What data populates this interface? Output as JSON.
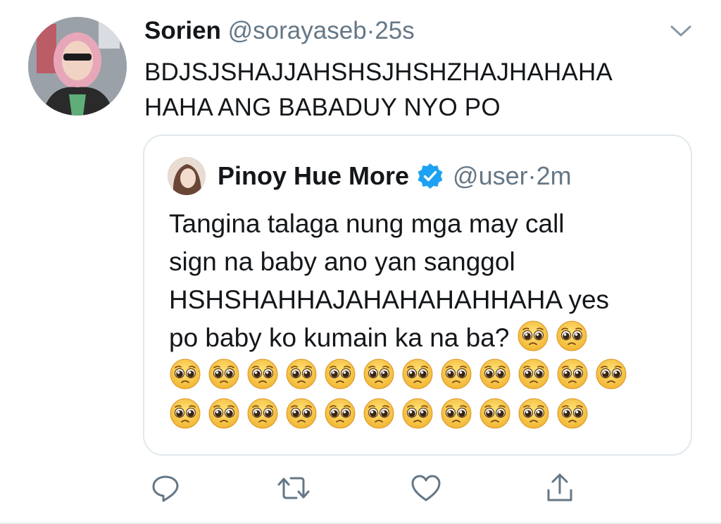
{
  "tweet": {
    "author_name": "Sorien",
    "author_handle": "@sorayaseb",
    "separator": "·",
    "time": "25s",
    "text_line1": "BDJSJSHAJJAHSHSJHSHZHAJHAHAHA",
    "text_line2": "HAHA ANG BABADUY NYO PO",
    "menu_icon": "chevron-down-icon"
  },
  "quoted_tweet": {
    "author_name": "Pinoy Hue More",
    "author_handle": "@user",
    "separator": "·",
    "time": "2m",
    "verified_icon": "verified-badge-icon",
    "text_line1": "Tangina talaga nung mga may call",
    "text_line2": "sign na baby ano yan sanggol",
    "text_line3": "HSHSHAHHAJAHAHAHAHHAHA yes",
    "text_line4": "po baby ko kumain ka na ba?",
    "emoji": "pleading-face",
    "emoji_count_line4": 2,
    "emoji_count_row2": 12,
    "emoji_count_row3": 11
  },
  "actions": [
    {
      "name": "reply",
      "icon": "reply-icon"
    },
    {
      "name": "retweet",
      "icon": "retweet-icon"
    },
    {
      "name": "like",
      "icon": "heart-icon"
    },
    {
      "name": "share",
      "icon": "share-icon"
    }
  ],
  "colors": {
    "text_primary": "#14171a",
    "text_secondary": "#657786",
    "verified_blue": "#1da1f2",
    "border": "#e1e8ed"
  }
}
